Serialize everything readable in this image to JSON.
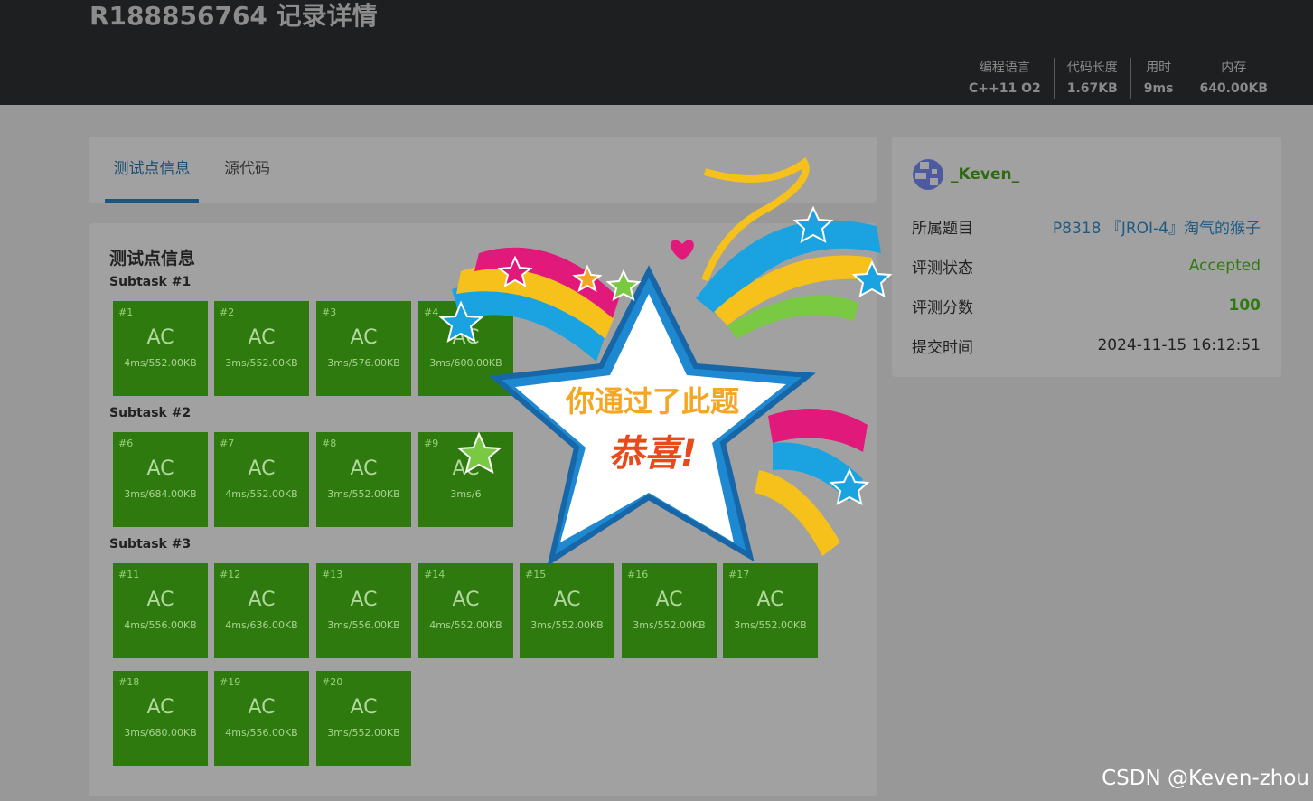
{
  "header": {
    "title": "R188856764 记录详情",
    "stats": [
      {
        "label": "编程语言",
        "value": "C++11 O2"
      },
      {
        "label": "代码长度",
        "value": "1.67KB"
      },
      {
        "label": "用时",
        "value": "9ms"
      },
      {
        "label": "内存",
        "value": "640.00KB"
      }
    ]
  },
  "tabs": [
    {
      "label": "测试点信息",
      "active": true
    },
    {
      "label": "源代码",
      "active": false
    }
  ],
  "tests": {
    "title": "测试点信息",
    "subtasks": [
      {
        "label": "Subtask #1",
        "cases": [
          {
            "num": "#1",
            "status": "AC",
            "stats": "4ms/552.00KB"
          },
          {
            "num": "#2",
            "status": "AC",
            "stats": "3ms/552.00KB"
          },
          {
            "num": "#3",
            "status": "AC",
            "stats": "3ms/576.00KB"
          },
          {
            "num": "#4",
            "status": "AC",
            "stats": "3ms/600.00KB"
          }
        ]
      },
      {
        "label": "Subtask #2",
        "cases": [
          {
            "num": "#6",
            "status": "AC",
            "stats": "3ms/684.00KB"
          },
          {
            "num": "#7",
            "status": "AC",
            "stats": "4ms/552.00KB"
          },
          {
            "num": "#8",
            "status": "AC",
            "stats": "3ms/552.00KB"
          },
          {
            "num": "#9",
            "status": "AC",
            "stats": "3ms/6"
          }
        ]
      },
      {
        "label": "Subtask #3",
        "cases": [
          {
            "num": "#11",
            "status": "AC",
            "stats": "4ms/556.00KB"
          },
          {
            "num": "#12",
            "status": "AC",
            "stats": "4ms/636.00KB"
          },
          {
            "num": "#13",
            "status": "AC",
            "stats": "3ms/556.00KB"
          },
          {
            "num": "#14",
            "status": "AC",
            "stats": "4ms/552.00KB"
          },
          {
            "num": "#15",
            "status": "AC",
            "stats": "3ms/552.00KB"
          },
          {
            "num": "#16",
            "status": "AC",
            "stats": "3ms/552.00KB"
          },
          {
            "num": "#17",
            "status": "AC",
            "stats": "3ms/552.00KB"
          },
          {
            "num": "#18",
            "status": "AC",
            "stats": "3ms/680.00KB"
          },
          {
            "num": "#19",
            "status": "AC",
            "stats": "4ms/556.00KB"
          },
          {
            "num": "#20",
            "status": "AC",
            "stats": "3ms/552.00KB"
          }
        ]
      }
    ]
  },
  "info": {
    "username": "_Keven_",
    "rows": [
      {
        "label": "所属题目",
        "value": "P8318 『JROI-4』淘气的猴子"
      },
      {
        "label": "评测状态",
        "value": "Accepted"
      },
      {
        "label": "评测分数",
        "value": "100"
      },
      {
        "label": "提交时间",
        "value": "2024-11-15 16:12:51"
      }
    ]
  },
  "overlay": {
    "line1": "你通过了此题",
    "line2": "恭喜!"
  },
  "watermark": "CSDN @Keven-zhou",
  "colors": {
    "ac_green": "#2e7a0e",
    "link_blue": "#1f5a85",
    "header_bg": "#1e1f20"
  }
}
